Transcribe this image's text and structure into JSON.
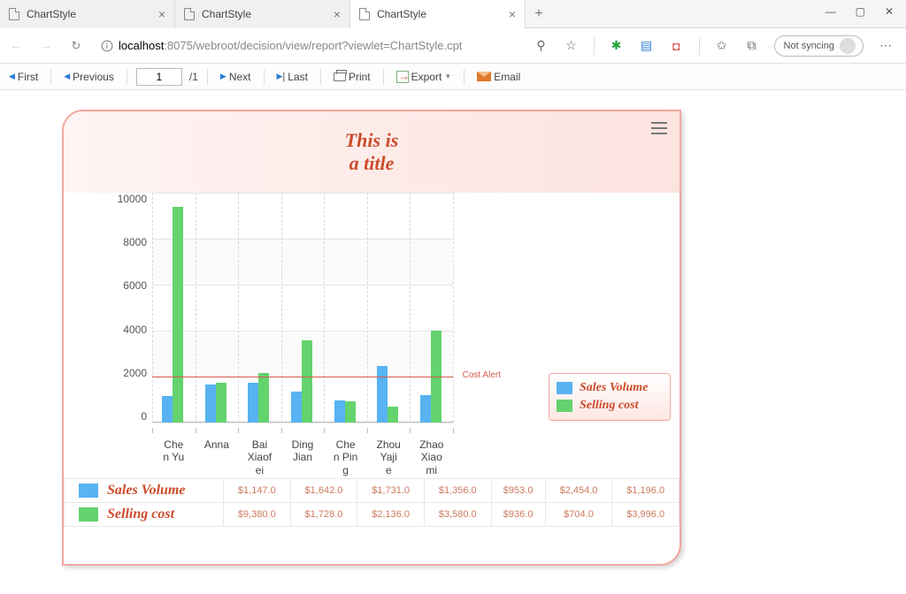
{
  "browser": {
    "tabs": [
      {
        "title": "ChartStyle",
        "active": false
      },
      {
        "title": "ChartStyle",
        "active": false
      },
      {
        "title": "ChartStyle",
        "active": true
      }
    ],
    "url_host": "localhost",
    "url_port_path": ":8075/webroot/decision/view/report?viewlet=ChartStyle.cpt",
    "not_syncing": "Not syncing"
  },
  "toolbar": {
    "first": "First",
    "previous": "Previous",
    "page_value": "1",
    "page_total_prefix": "/",
    "page_total": "1",
    "next": "Next",
    "last": "Last",
    "print": "Print",
    "export": "Export",
    "email": "Email"
  },
  "chart_data": {
    "type": "bar",
    "title": "This is\na title",
    "ylabel": "",
    "xlabel": "",
    "ylim": [
      0,
      10000
    ],
    "y_ticks": [
      0,
      2000,
      4000,
      6000,
      8000,
      10000
    ],
    "categories": [
      "Chen Yu",
      "Anna",
      "Bai Xiaofei",
      "Ding Jian",
      "Chen Ping",
      "Zhou Yajie",
      "Zhao Xiaomi"
    ],
    "categories_wrapped": [
      "Che\nn Yu",
      "Anna",
      "Bai\nXiaof\nei",
      "Ding\nJian",
      "Che\nn Pin\ng",
      "Zhou\nYaji\ne",
      "Zhao\nXiao\nmi"
    ],
    "series": [
      {
        "name": "Sales Volume",
        "color": "#57b3f1",
        "values": [
          1147.0,
          1642.0,
          1731.0,
          1356.0,
          953.0,
          2454.0,
          1196.0
        ]
      },
      {
        "name": "Selling cost",
        "color": "#63d36e",
        "values": [
          9380.0,
          1728.0,
          2136.0,
          3580.0,
          936.0,
          704.0,
          3996.0
        ]
      }
    ],
    "reference_line": {
      "label": "Cost Alert",
      "value": 2000
    },
    "table_display": {
      "Sales Volume": [
        "$1,147.0",
        "$1,642.0",
        "$1,731.0",
        "$1,356.0",
        "$953.0",
        "$2,454.0",
        "$1,196.0"
      ],
      "Selling cost": [
        "$9,380.0",
        "$1,728.0",
        "$2,136.0",
        "$3,580.0",
        "$936.0",
        "$704.0",
        "$3,996.0"
      ]
    }
  }
}
